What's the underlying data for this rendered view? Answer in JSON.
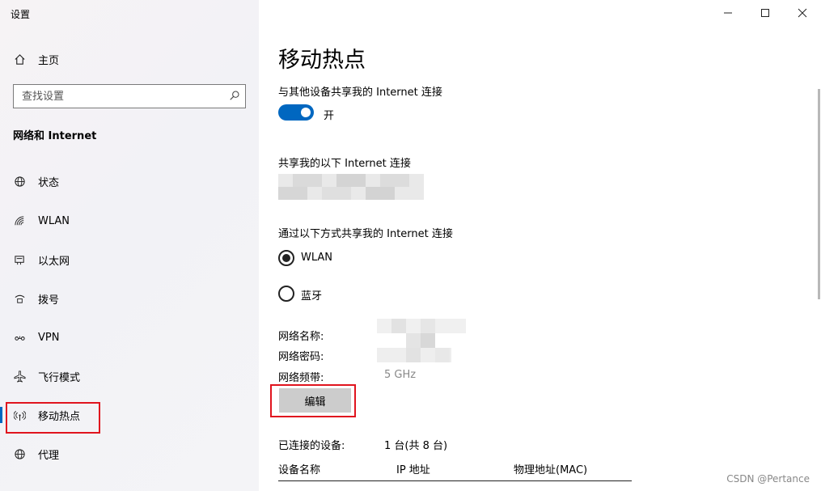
{
  "app": {
    "title": "设置"
  },
  "sidebar": {
    "home_label": "主页",
    "search_placeholder": "查找设置",
    "section_title": "网络和 Internet",
    "items": [
      {
        "label": "状态",
        "icon": "globe-icon"
      },
      {
        "label": "WLAN",
        "icon": "wifi-icon"
      },
      {
        "label": "以太网",
        "icon": "ethernet-icon"
      },
      {
        "label": "拨号",
        "icon": "dialup-icon"
      },
      {
        "label": "VPN",
        "icon": "vpn-icon"
      },
      {
        "label": "飞行模式",
        "icon": "airplane-icon"
      },
      {
        "label": "移动热点",
        "icon": "hotspot-icon",
        "active": true
      },
      {
        "label": "代理",
        "icon": "proxy-globe-icon"
      }
    ]
  },
  "window": {
    "minimize": "—",
    "maximize": "☐",
    "close": "✕"
  },
  "main": {
    "title": "移动热点",
    "share_label": "与其他设备共享我的 Internet 连接",
    "toggle_state": "开",
    "share_from_label": "共享我的以下 Internet 连接",
    "share_via_label": "通过以下方式共享我的 Internet 连接",
    "options": [
      {
        "label": "WLAN",
        "selected": true
      },
      {
        "label": "蓝牙",
        "selected": false
      }
    ],
    "network_name_label": "网络名称:",
    "network_password_label": "网络密码:",
    "network_band_label": "网络频带:",
    "network_band_value": "5 GHz",
    "edit_button": "编辑",
    "connected_label": "已连接的设备:",
    "connected_value": "1 台(共 8 台)",
    "table_headers": [
      "设备名称",
      "IP 地址",
      "物理地址(MAC)"
    ]
  },
  "watermark": "CSDN @Pertance",
  "colors": {
    "accent": "#0067c0",
    "highlight_box": "#e0141e",
    "button_bg": "#cccccc"
  }
}
